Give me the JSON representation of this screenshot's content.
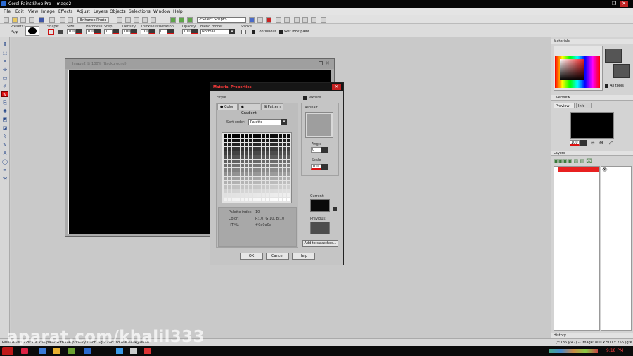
{
  "app": {
    "title": "Corel Paint Shop Pro - Image2"
  },
  "menu": [
    "File",
    "Edit",
    "View",
    "Image",
    "Effects",
    "Adjust",
    "Layers",
    "Objects",
    "Selections",
    "Window",
    "Help"
  ],
  "toolbar": {
    "enhance_photo": "Enhance Photo",
    "select_script": "<Select Script>"
  },
  "tool_options": {
    "presets_label": "Presets:",
    "shape_label": "Shape:",
    "size_label": "Size:",
    "size_value": "100",
    "hardness_label": "Hardness:",
    "hardness_value": "100",
    "step_label": "Step:",
    "step_value": "1",
    "density_label": "Density:",
    "density_value": "100",
    "thickness_label": "Thickness:",
    "thickness_value": "100",
    "rotation_label": "Rotation:",
    "rotation_value": "0",
    "opacity_label": "Opacity:",
    "opacity_value": "100",
    "blend_label": "Blend mode:",
    "blend_value": "Normal",
    "stroke_label": "Stroke:",
    "continuous": "Continuous",
    "wet_look": "Wet look paint"
  },
  "image_window": {
    "title": "Image2 @ 100% (Background)"
  },
  "dialog": {
    "title": "Material Properties",
    "style_label": "Style",
    "tabs": [
      "Color",
      "Gradient",
      "Pattern"
    ],
    "sort_label": "Sort order:",
    "sort_value": "Palette",
    "texture_label": "Texture",
    "texture_name": "Asphalt",
    "angle_label": "Angle",
    "angle_value": "0",
    "scale_label": "Scale",
    "scale_value": "100",
    "palette_index_label": "Palette index:",
    "palette_index_value": "10",
    "color_label": "Color:",
    "color_value": "R:10, G:10, B:10",
    "html_label": "HTML:",
    "html_value": "#0a0a0a",
    "current_label": "Current",
    "previous_label": "Previous:",
    "add_swatches": "Add to swatches...",
    "ok": "OK",
    "cancel": "Cancel",
    "help": "Help"
  },
  "panels": {
    "materials": "Materials",
    "all_tools": "All tools",
    "overview": "Overview",
    "preview_tab": "Preview",
    "info_tab": "Info",
    "zoom_value": "100",
    "layers": "Layers",
    "history": "History"
  },
  "status": {
    "left": "Paint Brush Tool: Click to paint with the primary color, right click to use background",
    "right": "(x:786 y:47) -- Image: 800 x 500 x 256 (grey)"
  },
  "taskbar": {
    "time": "9:18 PM"
  },
  "watermark": "aparat.com/khalil333",
  "colors": {
    "accent": "#d11919",
    "dialog_title": "#ff3b3b",
    "canvas": "#000000"
  }
}
